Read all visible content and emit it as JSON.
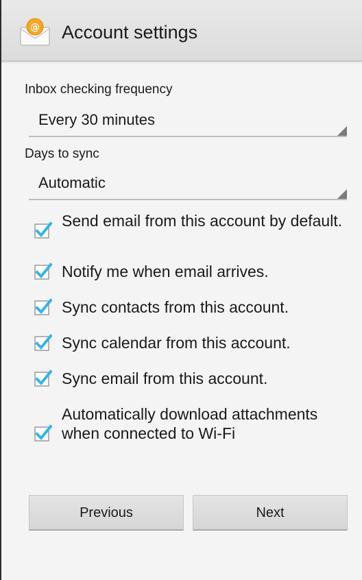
{
  "header": {
    "title": "Account settings",
    "icon": "email-app-icon"
  },
  "fields": {
    "inbox_frequency": {
      "label": "Inbox checking frequency",
      "value": "Every 30 minutes"
    },
    "days_to_sync": {
      "label": "Days to sync",
      "value": "Automatic"
    }
  },
  "options": [
    {
      "label": "Send email from this account by default.",
      "checked": true
    },
    {
      "label": "Notify me when email arrives.",
      "checked": true
    },
    {
      "label": "Sync contacts from this account.",
      "checked": true
    },
    {
      "label": "Sync calendar from this account.",
      "checked": true
    },
    {
      "label": "Sync email from this account.",
      "checked": true
    },
    {
      "label": "Automatically download attachments when connected to Wi-Fi",
      "checked": true
    }
  ],
  "buttons": {
    "previous": "Previous",
    "next": "Next"
  },
  "colors": {
    "check_accent": "#33b5e5",
    "action_bar": "#e2e2e2",
    "background": "#f4f4f4"
  }
}
